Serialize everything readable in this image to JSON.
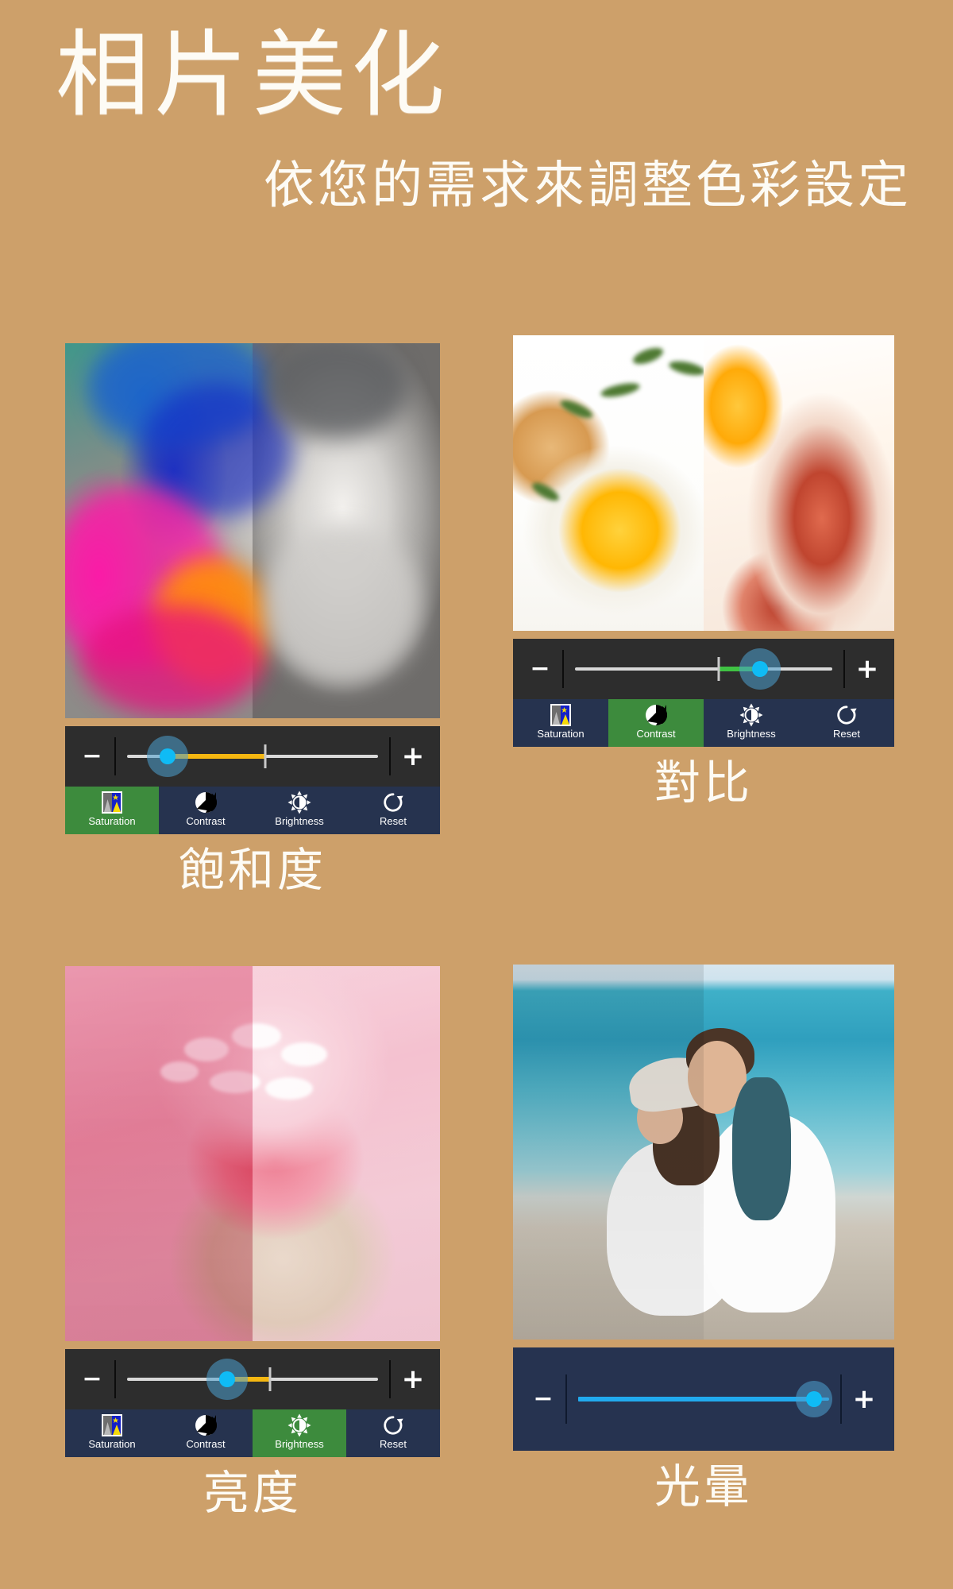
{
  "header": {
    "title": "相片美化",
    "subtitle": "依您的需求來調整色彩設定"
  },
  "theme": {
    "background": "#cda06a",
    "toolbar_bg": "#2d2d2d",
    "button_bg": "#26334f",
    "active_bg": "#3d8b3d",
    "knob_color": "#0fbbf5",
    "text_color": "#ffffff",
    "caption_color": "#fdfbf5"
  },
  "controls": {
    "minus_label": "−",
    "plus_label": "+"
  },
  "panels": [
    {
      "id": "saturation",
      "caption": "飽和度",
      "photo": "rose-split-color-grayscale",
      "slider": {
        "knob_percent": 16,
        "fill_from_percent": 16,
        "fill_to_percent": 55,
        "fill_color": "#f5b711",
        "tick_percent": 55,
        "track_color": "#d9d9d9"
      },
      "buttons": [
        {
          "label": "Saturation",
          "icon": "saturation-icon",
          "active": true
        },
        {
          "label": "Contrast",
          "icon": "contrast-icon",
          "active": false
        },
        {
          "label": "Brightness",
          "icon": "brightness-icon",
          "active": false
        },
        {
          "label": "Reset",
          "icon": "reset-icon",
          "active": false
        }
      ]
    },
    {
      "id": "contrast",
      "caption": "對比",
      "photo": "breakfast-eggs-bacon-split",
      "slider": {
        "knob_percent": 72,
        "fill_from_percent": 56,
        "fill_to_percent": 72,
        "fill_color": "#3fc243",
        "tick_percent": 56,
        "track_color": "#d9d9d9"
      },
      "buttons": [
        {
          "label": "Saturation",
          "icon": "saturation-icon",
          "active": false
        },
        {
          "label": "Contrast",
          "icon": "contrast-icon",
          "active": true
        },
        {
          "label": "Brightness",
          "icon": "brightness-icon",
          "active": false
        },
        {
          "label": "Reset",
          "icon": "reset-icon",
          "active": false
        }
      ]
    },
    {
      "id": "brightness",
      "caption": "亮度",
      "photo": "cupcake-pink-split",
      "slider": {
        "knob_percent": 40,
        "fill_from_percent": 40,
        "fill_to_percent": 57,
        "fill_color": "#f5b711",
        "tick_percent": 57,
        "track_color": "#d9d9d9"
      },
      "buttons": [
        {
          "label": "Saturation",
          "icon": "saturation-icon",
          "active": false
        },
        {
          "label": "Contrast",
          "icon": "contrast-icon",
          "active": false
        },
        {
          "label": "Brightness",
          "icon": "brightness-icon",
          "active": true
        },
        {
          "label": "Reset",
          "icon": "reset-icon",
          "active": false
        }
      ]
    },
    {
      "id": "glow",
      "caption": "光暈",
      "photo": "beach-couple-split",
      "slider": {
        "knob_percent": 94,
        "fill_from_percent": 0,
        "fill_to_percent": 94,
        "fill_color": "#21aaee",
        "tick_percent": -1,
        "track_color": "#21aaee"
      },
      "buttons": []
    }
  ]
}
